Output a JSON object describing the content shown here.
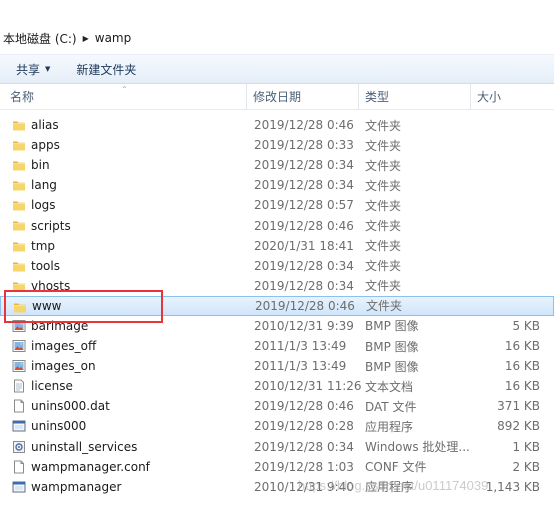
{
  "address": {
    "drive": "本地磁盘 (C:)",
    "folder": "wamp"
  },
  "toolbar": {
    "share_label": "共享",
    "new_folder_label": "新建文件夹"
  },
  "columns": {
    "name": "名称",
    "date": "修改日期",
    "type": "类型",
    "size": "大小"
  },
  "files": [
    {
      "name": "alias",
      "date": "2019/12/28 0:46",
      "type": "文件夹",
      "size": "",
      "icon": "folder-icon"
    },
    {
      "name": "apps",
      "date": "2019/12/28 0:33",
      "type": "文件夹",
      "size": "",
      "icon": "folder-icon"
    },
    {
      "name": "bin",
      "date": "2019/12/28 0:34",
      "type": "文件夹",
      "size": "",
      "icon": "folder-icon"
    },
    {
      "name": "lang",
      "date": "2019/12/28 0:34",
      "type": "文件夹",
      "size": "",
      "icon": "folder-icon"
    },
    {
      "name": "logs",
      "date": "2019/12/28 0:57",
      "type": "文件夹",
      "size": "",
      "icon": "folder-icon"
    },
    {
      "name": "scripts",
      "date": "2019/12/28 0:46",
      "type": "文件夹",
      "size": "",
      "icon": "folder-icon"
    },
    {
      "name": "tmp",
      "date": "2020/1/31 18:41",
      "type": "文件夹",
      "size": "",
      "icon": "folder-icon"
    },
    {
      "name": "tools",
      "date": "2019/12/28 0:34",
      "type": "文件夹",
      "size": "",
      "icon": "folder-icon"
    },
    {
      "name": "vhosts",
      "date": "2019/12/28 0:34",
      "type": "文件夹",
      "size": "",
      "icon": "folder-icon"
    },
    {
      "name": "www",
      "date": "2019/12/28 0:46",
      "type": "文件夹",
      "size": "",
      "icon": "folder-icon",
      "selected": true
    },
    {
      "name": "barimage",
      "date": "2010/12/31 9:39",
      "type": "BMP 图像",
      "size": "5 KB",
      "icon": "bmp-image-icon"
    },
    {
      "name": "images_off",
      "date": "2011/1/3 13:49",
      "type": "BMP 图像",
      "size": "16 KB",
      "icon": "bmp-image-icon"
    },
    {
      "name": "images_on",
      "date": "2011/1/3 13:49",
      "type": "BMP 图像",
      "size": "16 KB",
      "icon": "bmp-image-icon"
    },
    {
      "name": "license",
      "date": "2010/12/31 11:26",
      "type": "文本文档",
      "size": "16 KB",
      "icon": "text-document-icon"
    },
    {
      "name": "unins000.dat",
      "date": "2019/12/28 0:46",
      "type": "DAT 文件",
      "size": "371 KB",
      "icon": "blank-file-icon"
    },
    {
      "name": "unins000",
      "date": "2019/12/28 0:28",
      "type": "应用程序",
      "size": "892 KB",
      "icon": "application-icon"
    },
    {
      "name": "uninstall_services",
      "date": "2019/12/28 0:34",
      "type": "Windows 批处理...",
      "size": "1 KB",
      "icon": "batch-file-icon"
    },
    {
      "name": "wampmanager.conf",
      "date": "2019/12/28 1:03",
      "type": "CONF 文件",
      "size": "2 KB",
      "icon": "blank-file-icon"
    },
    {
      "name": "wampmanager",
      "date": "2010/12/31 9:40",
      "type": "应用程序",
      "size": "1,143 KB",
      "icon": "application-icon"
    }
  ],
  "watermark": "https://blog.csdn.net/u011174039",
  "colors": {
    "selection": "#cfe5fb",
    "highlight_box": "#e8353a",
    "folder": "#f0c64a"
  }
}
